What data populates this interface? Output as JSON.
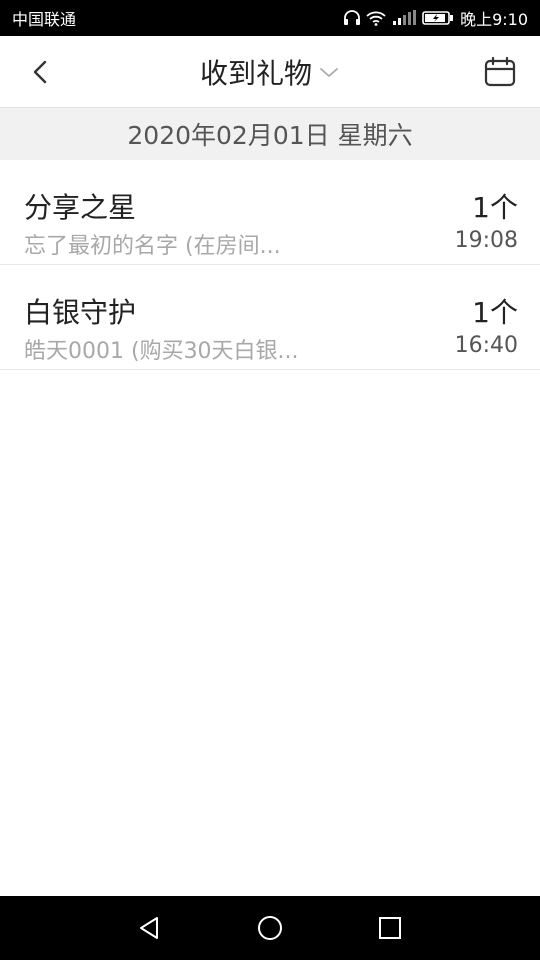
{
  "status_bar": {
    "carrier": "中国联通",
    "time": "晚上9:10",
    "icons": [
      "headphones-icon",
      "wifi-icon",
      "4g-signal-icon",
      "battery-charging-icon"
    ]
  },
  "header": {
    "title": "收到礼物",
    "back_icon": "back-chevron-icon",
    "dropdown_icon": "chevron-down-icon",
    "calendar_icon": "calendar-icon"
  },
  "date_bar": {
    "date": "2020年02月01日 星期六"
  },
  "gifts": [
    {
      "name": "分享之星",
      "desc": "忘了最初的名字 (在房间...",
      "count": "1个",
      "time": "19:08"
    },
    {
      "name": "白银守护",
      "desc": "皓天0001 (购买30天白银...",
      "count": "1个",
      "time": "16:40"
    }
  ],
  "nav_bar": {
    "icons": [
      "nav-back-icon",
      "nav-home-icon",
      "nav-recents-icon"
    ]
  },
  "colors": {
    "status_bg": "#000000",
    "header_bg": "#ffffff",
    "date_bar_bg": "#f1f1f1",
    "primary_text": "#222222",
    "secondary_text": "#a8a8a8"
  }
}
